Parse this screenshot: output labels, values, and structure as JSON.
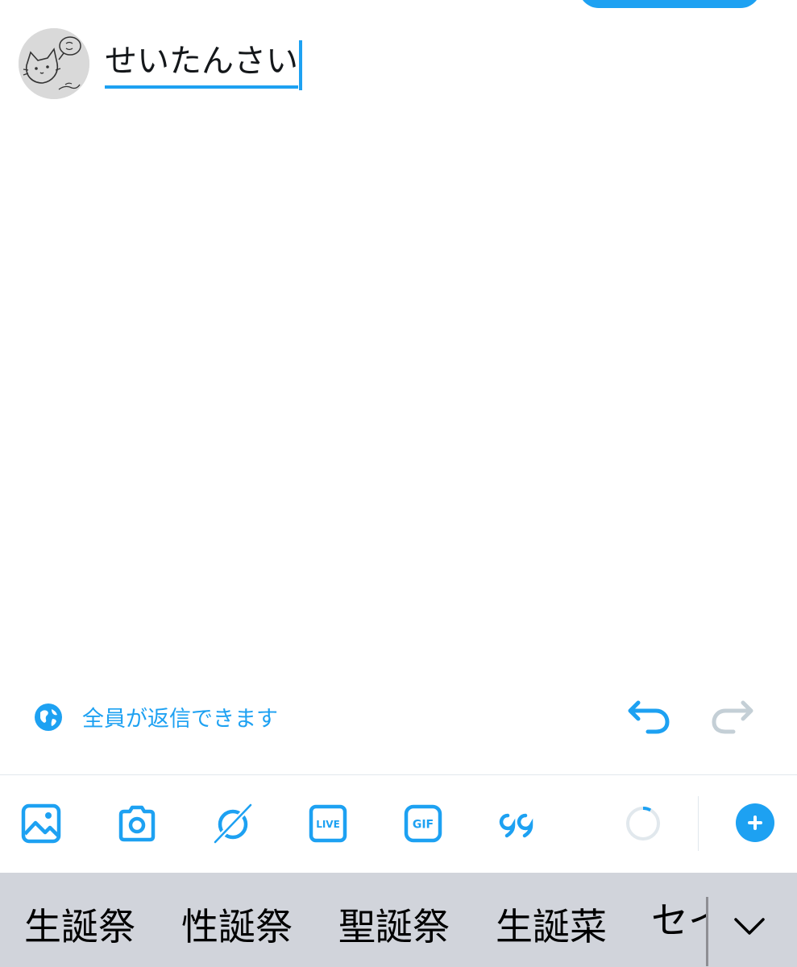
{
  "compose": {
    "text": "せいたんさい"
  },
  "reply_setting": {
    "label": "全員が返信できます",
    "icon": "globe-icon"
  },
  "history": {
    "undo_icon": "undo-icon",
    "redo_icon": "redo-icon"
  },
  "toolbar": {
    "items": [
      {
        "icon": "image-icon"
      },
      {
        "icon": "camera-icon"
      },
      {
        "icon": "fleet-icon"
      },
      {
        "icon": "live-icon",
        "label": "LIVE"
      },
      {
        "icon": "gif-icon",
        "label": "GIF"
      },
      {
        "icon": "quote-icon"
      }
    ],
    "char_counter_progress": 0.08,
    "add_icon": "plus-icon"
  },
  "keyboard": {
    "suggestions": [
      "生誕祭",
      "性誕祭",
      "聖誕祭",
      "生誕菜",
      "セイ"
    ],
    "expand_icon": "chevron-down-icon"
  },
  "colors": {
    "accent": "#1da1f2",
    "keyboard_bg": "#d1d4db",
    "disabled": "#c4cfd6"
  }
}
